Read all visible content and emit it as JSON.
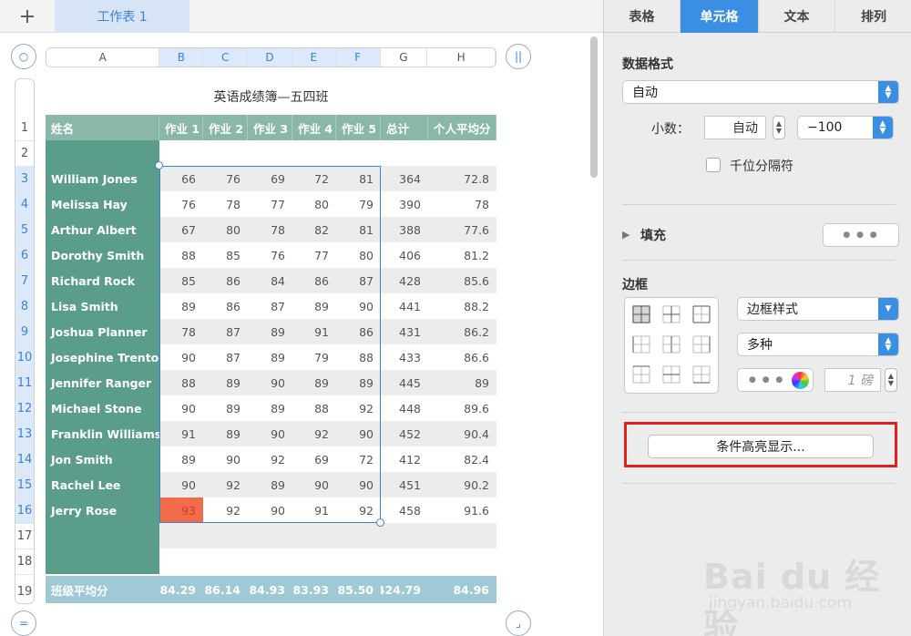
{
  "tabbar": {
    "add_label": "+",
    "sheet_tab": "工作表 1"
  },
  "controls": {
    "top_left_circle": "○",
    "top_right_circle": "||",
    "bottom_left_circle": "=",
    "bottom_right_circle": "⌟"
  },
  "columns": [
    "A",
    "B",
    "C",
    "D",
    "E",
    "F",
    "G",
    "H"
  ],
  "rows": [
    "1",
    "2",
    "3",
    "4",
    "5",
    "6",
    "7",
    "8",
    "9",
    "10",
    "11",
    "12",
    "13",
    "14",
    "15",
    "16",
    "17",
    "18",
    "19"
  ],
  "table": {
    "title": "英语成绩簿—五四班",
    "headers": [
      "姓名",
      "作业 1",
      "作业 2",
      "作业 3",
      "作业 4",
      "作业 5",
      "总计",
      "个人平均分"
    ],
    "students": [
      {
        "name": "William Jones",
        "scores": [
          "66",
          "76",
          "69",
          "72",
          "81"
        ],
        "total": "364",
        "avg": "72.8"
      },
      {
        "name": "Melissa Hay",
        "scores": [
          "76",
          "78",
          "77",
          "80",
          "79"
        ],
        "total": "390",
        "avg": "78"
      },
      {
        "name": "Arthur Albert",
        "scores": [
          "67",
          "80",
          "78",
          "82",
          "81"
        ],
        "total": "388",
        "avg": "77.6"
      },
      {
        "name": "Dorothy Smith",
        "scores": [
          "88",
          "85",
          "76",
          "77",
          "80"
        ],
        "total": "406",
        "avg": "81.2"
      },
      {
        "name": "Richard Rock",
        "scores": [
          "85",
          "86",
          "84",
          "86",
          "87"
        ],
        "total": "428",
        "avg": "85.6"
      },
      {
        "name": "Lisa Smith",
        "scores": [
          "89",
          "86",
          "87",
          "89",
          "90"
        ],
        "total": "441",
        "avg": "88.2"
      },
      {
        "name": "Joshua Planner",
        "scores": [
          "78",
          "87",
          "89",
          "91",
          "86"
        ],
        "total": "431",
        "avg": "86.2"
      },
      {
        "name": "Josephine Trenton",
        "scores": [
          "90",
          "87",
          "89",
          "79",
          "88"
        ],
        "total": "433",
        "avg": "86.6"
      },
      {
        "name": "Jennifer Ranger",
        "scores": [
          "88",
          "89",
          "90",
          "89",
          "89"
        ],
        "total": "445",
        "avg": "89"
      },
      {
        "name": "Michael Stone",
        "scores": [
          "90",
          "89",
          "89",
          "88",
          "92"
        ],
        "total": "448",
        "avg": "89.6"
      },
      {
        "name": "Franklin Williams",
        "scores": [
          "91",
          "89",
          "90",
          "92",
          "90"
        ],
        "total": "452",
        "avg": "90.4"
      },
      {
        "name": "Jon Smith",
        "scores": [
          "89",
          "90",
          "92",
          "69",
          "72"
        ],
        "total": "412",
        "avg": "82.4"
      },
      {
        "name": "Rachel Lee",
        "scores": [
          "90",
          "92",
          "89",
          "90",
          "90"
        ],
        "total": "451",
        "avg": "90.2"
      },
      {
        "name": "Jerry Rose",
        "scores": [
          "93",
          "92",
          "90",
          "91",
          "92"
        ],
        "total": "458",
        "avg": "91.6"
      }
    ],
    "footer": {
      "label": "班级平均分",
      "values": [
        "84.29",
        "86.14",
        "84.93",
        "83.93",
        "85.50",
        "424.79",
        "84.96"
      ]
    },
    "highlight_color": "#f26b4b"
  },
  "panel": {
    "tabs": [
      "表格",
      "单元格",
      "文本",
      "排列"
    ],
    "active_tab": "单元格",
    "data_format_label": "数据格式",
    "data_format_value": "自动",
    "decimal_label": "小数：",
    "decimal_value": "自动",
    "negative_value": "−100",
    "thousands_label": "千位分隔符",
    "fill_label": "填充",
    "fill_button": "● ● ●",
    "border_label": "边框",
    "border_style": "边框样式",
    "border_type": "多种",
    "border_color_dots": "● ● ●",
    "border_width": "1 磅",
    "conditional_highlight": "条件高亮显示..."
  },
  "watermark": {
    "brand": "Bai du 经验",
    "url": "jingyan.baidu.com"
  },
  "colors": {
    "accent": "#3a8fe2",
    "header_green": "#8ab8a8",
    "name_green": "#5a9d8a",
    "footer_blue": "#9fc9d4",
    "red_box": "#e32020"
  }
}
